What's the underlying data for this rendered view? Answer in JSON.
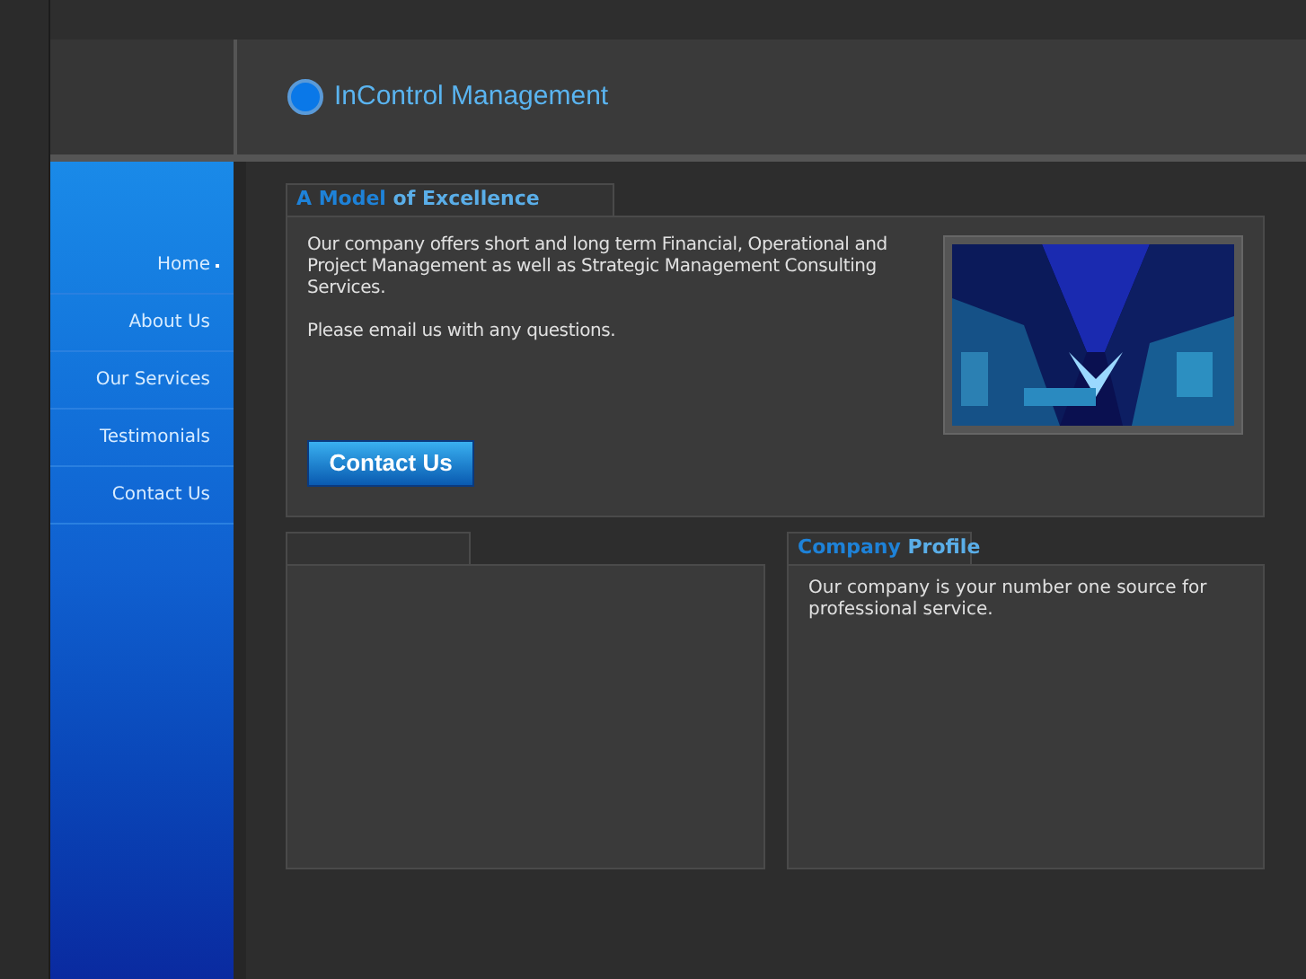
{
  "header": {
    "title": "InControl Management"
  },
  "nav": [
    {
      "label": "Home",
      "selected": true
    },
    {
      "label": "About Us",
      "selected": false
    },
    {
      "label": "Our Services",
      "selected": false
    },
    {
      "label": "Testimonials",
      "selected": false
    },
    {
      "label": "Contact Us",
      "selected": false
    }
  ],
  "intro": {
    "title_lead": "A Model",
    "title_rest": "of Excellence",
    "paragraphs": [
      "Our company offers short and long term Financial, Operational and Project Management as well as Strategic Management Consulting Services.",
      "Please email us with any questions."
    ],
    "button": "Contact Us"
  },
  "profile": {
    "title_lead": "Company",
    "title_rest": "Profile",
    "text": "Our company is your number one source for professional service."
  }
}
